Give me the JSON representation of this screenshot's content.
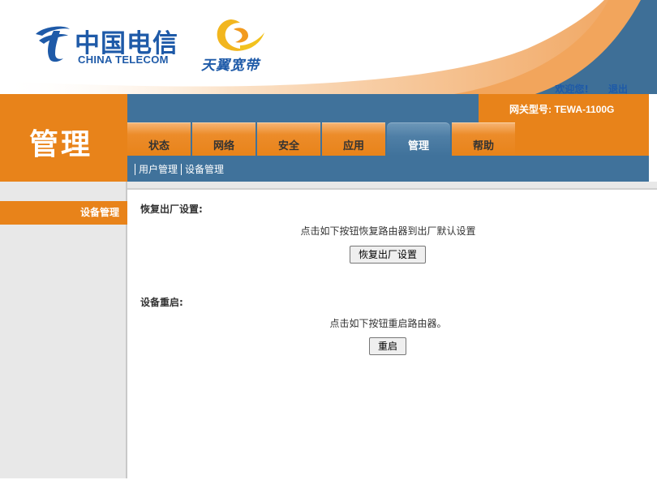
{
  "header": {
    "brand_zh": "中国电信",
    "brand_en": "CHINA TELECOM",
    "subbrand_zh": "天翼宽带",
    "welcome": "欢迎您!",
    "logout": "退出"
  },
  "section_title": "管理",
  "model_label": "网关型号: TEWA-1100G",
  "tabs": [
    {
      "label": "状态"
    },
    {
      "label": "网络"
    },
    {
      "label": "安全"
    },
    {
      "label": "应用"
    },
    {
      "label": "管理",
      "active": true
    },
    {
      "label": "帮助"
    }
  ],
  "subnav": [
    {
      "label": "用户管理"
    },
    {
      "label": "设备管理"
    }
  ],
  "sidebar": {
    "items": [
      {
        "label": "设备管理",
        "active": true
      }
    ]
  },
  "factory_reset": {
    "title": "恢复出厂设置:",
    "desc": "点击如下按钮恢复路由器到出厂默认设置",
    "button": "恢复出厂设置"
  },
  "reboot": {
    "title": "设备重启:",
    "desc": "点击如下按钮重启路由器。",
    "button": "重启"
  },
  "colors": {
    "orange": "#e8831a",
    "blue": "#40729b",
    "brand_blue": "#1e5aa8"
  }
}
